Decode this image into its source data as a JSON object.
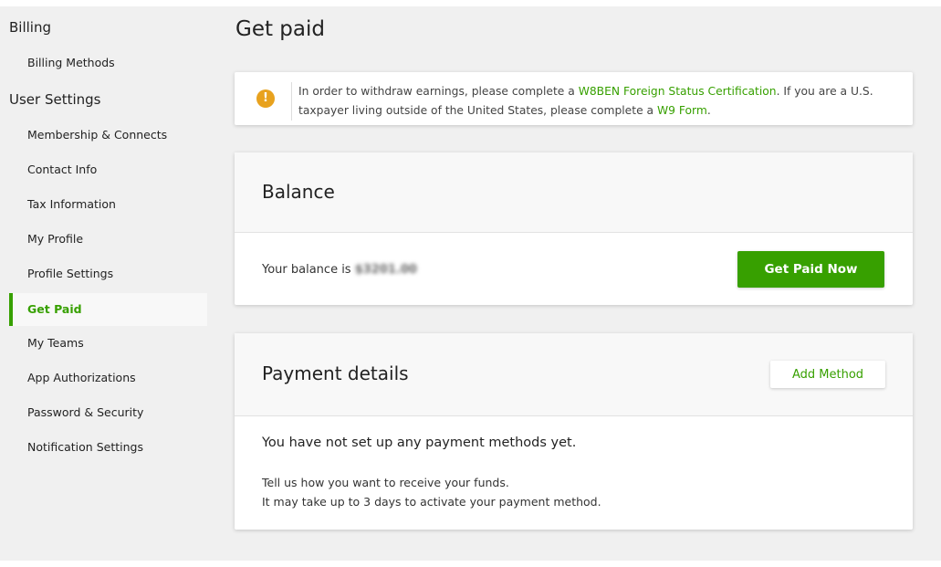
{
  "sidebar": {
    "sections": [
      {
        "heading": "Billing",
        "items": [
          {
            "label": "Billing Methods"
          }
        ]
      },
      {
        "heading": "User Settings",
        "items": [
          {
            "label": "Membership & Connects"
          },
          {
            "label": "Contact Info"
          },
          {
            "label": "Tax Information"
          },
          {
            "label": "My Profile"
          },
          {
            "label": "Profile Settings"
          },
          {
            "label": "Get Paid",
            "active": true
          },
          {
            "label": "My Teams"
          },
          {
            "label": "App Authorizations"
          },
          {
            "label": "Password & Security"
          },
          {
            "label": "Notification Settings"
          }
        ]
      }
    ]
  },
  "page": {
    "title": "Get paid"
  },
  "alert": {
    "icon": "warning-icon",
    "text_before": "In order to withdraw earnings, please complete a ",
    "link1": "W8BEN Foreign Status Certification",
    "text_middle": ". If you are a U.S. taxpayer living outside of the United States, please complete a ",
    "link2": "W9 Form",
    "text_after": "."
  },
  "balance": {
    "title": "Balance",
    "label": "Your balance is ",
    "value": "$3201.00",
    "value_obscured": true,
    "button": "Get Paid Now"
  },
  "payment": {
    "title": "Payment details",
    "add_button": "Add Method",
    "empty_heading": "You have not set up any payment methods yet.",
    "line1": "Tell us how you want to receive your funds.",
    "line2": "It may take up to 3 days to activate your payment method."
  },
  "colors": {
    "accent": "#37a000",
    "warning": "#e8a21e",
    "background": "#f0f0f0"
  }
}
